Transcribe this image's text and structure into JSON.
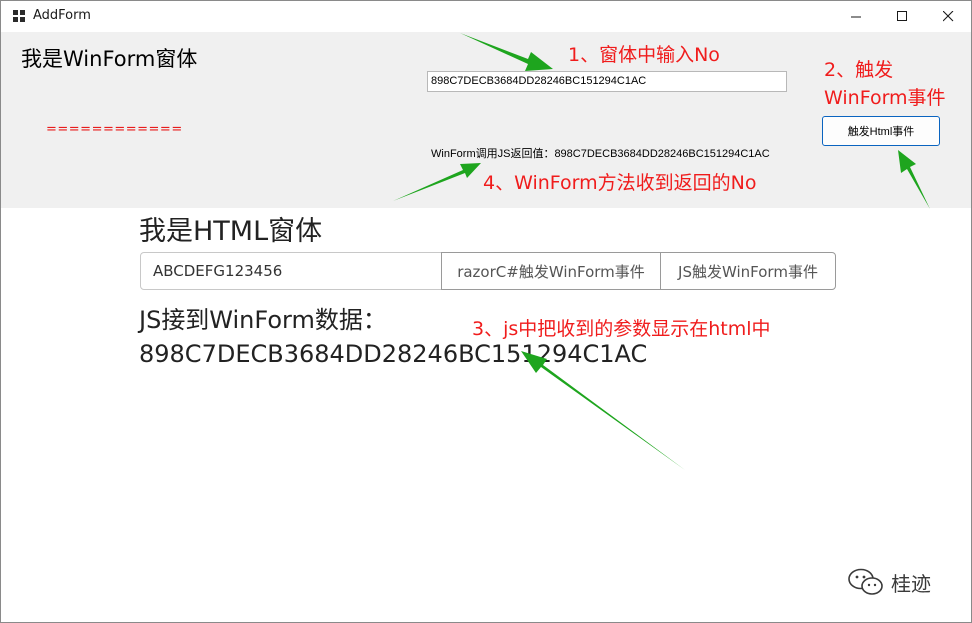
{
  "window": {
    "title": "AddForm"
  },
  "winform": {
    "title": "我是WinForm窗体",
    "dashes": "============",
    "input_value": "898C7DECB3684DD28246BC151294C1AC",
    "button_label": "触发Html事件",
    "result_text": "WinForm调用JS返回值：898C7DECB3684DD28246BC151294C1AC"
  },
  "html": {
    "title": "我是HTML窗体",
    "input_value": "ABCDEFG123456",
    "button1_label": "razorC#触发WinForm事件",
    "button2_label": "JS触发WinForm事件",
    "received_label": "JS接到WinForm数据：",
    "received_value": "898C7DECB3684DD28246BC151294C1AC"
  },
  "annotations": {
    "step1": "1、窗体中输入No",
    "step2_line1": "2、触发",
    "step2_line2": "WinForm事件",
    "step3": "3、js中把收到的参数显示在html中",
    "step4": "4、WinForm方法收到返回的No"
  },
  "watermark": {
    "text": "桂迹",
    "icon": "wechat-icon"
  },
  "colors": {
    "annotation": "#f01c1c",
    "arrow": "#1ea51e",
    "winform_bg": "#f0f0f0",
    "button_border": "#0a64c0"
  }
}
